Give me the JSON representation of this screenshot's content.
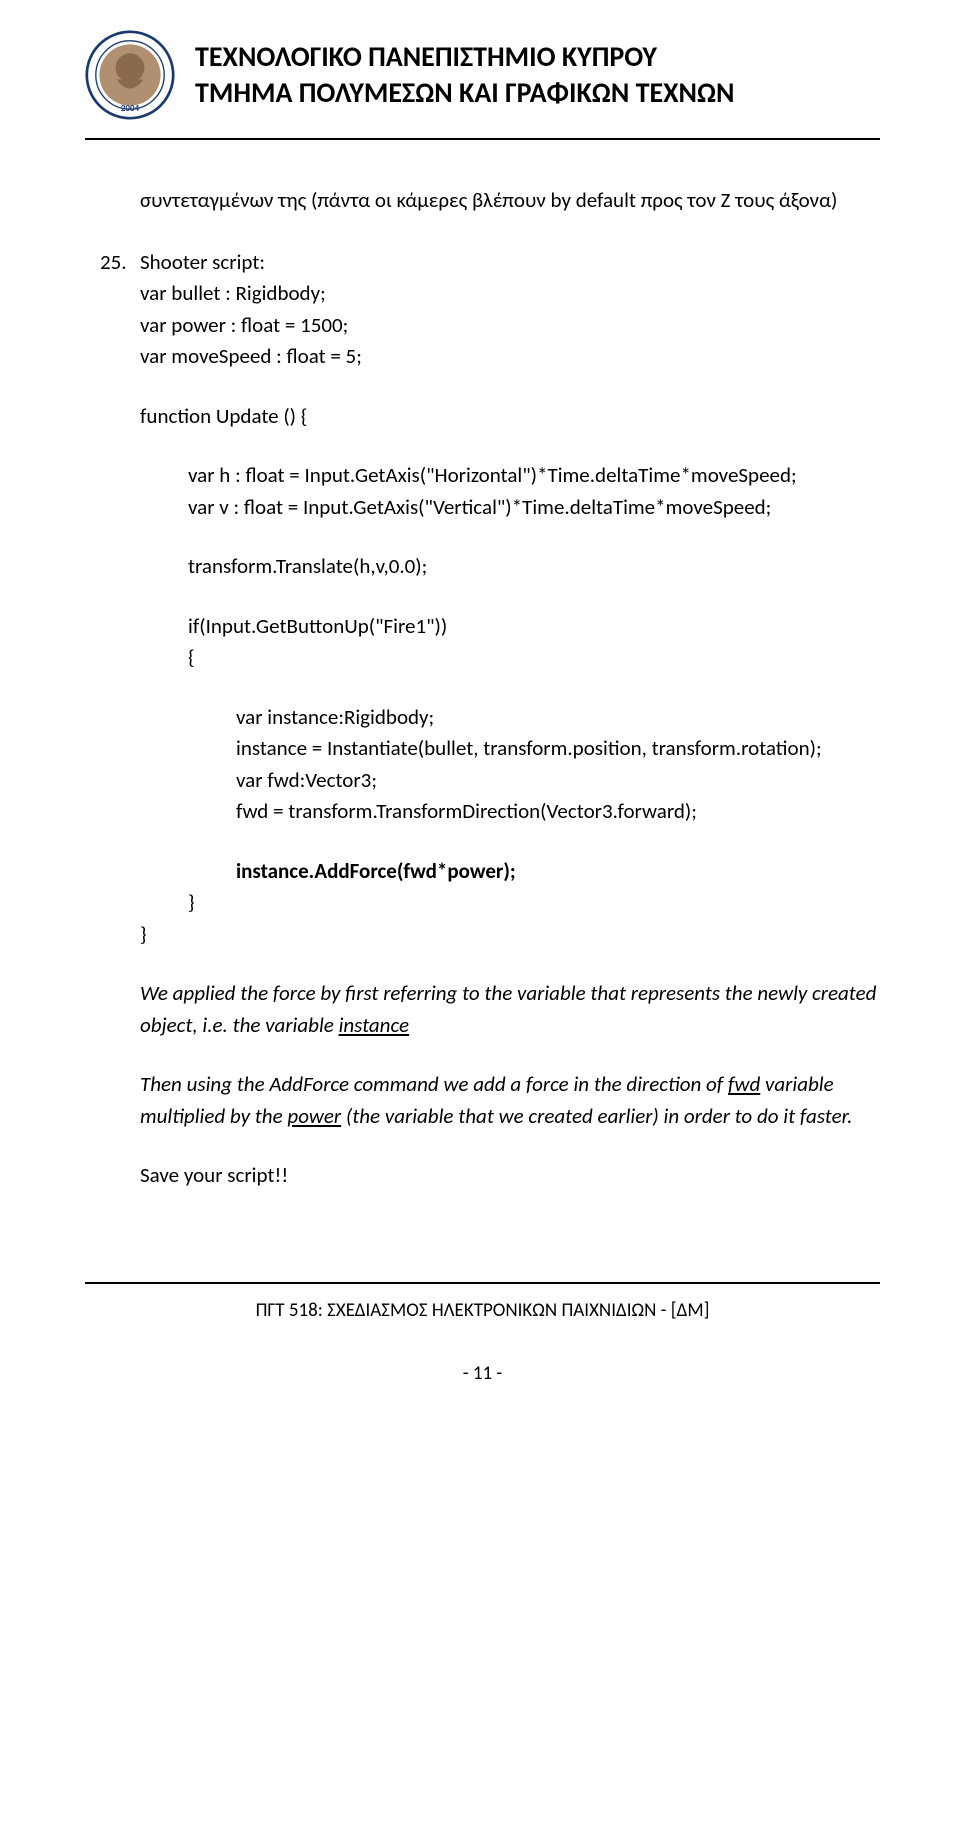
{
  "header": {
    "title_line1": "ΤΕΧΝΟΛΟΓΙΚΟ ΠΑΝΕΠΙΣΤΗΜΙΟ ΚΥΠΡΟΥ",
    "title_line2": "ΤΜΗΜΑ ΠΟΛΥΜΕΣΩΝ ΚΑΙ ΓΡΑΦΙΚΩΝ ΤΕΧΝΩΝ"
  },
  "body": {
    "intro_part1": "συντεταγμένων της (πάντα οι κάμερες βλέπουν by default προς τον Ζ τους άξονα)",
    "list_number": "25.",
    "list_title": "Shooter script:",
    "code": {
      "l1": "var bullet : Rigidbody;",
      "l2": "var power : float = 1500;",
      "l3": "var moveSpeed : float = 5;",
      "l4": "function Update () {",
      "l5": "var h : float = Input.GetAxis(\"Horizontal\")*Time.deltaTime*moveSpeed;",
      "l6": "var v : float = Input.GetAxis(\"Vertical\")*Time.deltaTime*moveSpeed;",
      "l7": "transform.Translate(h,v,0.0);",
      "l8": "if(Input.GetButtonUp(\"Fire1\"))",
      "l9": "{",
      "l10": "var instance:Rigidbody;",
      "l11": "instance = Instantiate(bullet, transform.position, transform.rotation);",
      "l12": "var fwd:Vector3;",
      "l13": "fwd = transform.TransformDirection(Vector3.forward);",
      "l14": "instance.AddForce(fwd*power);",
      "l15a": "}",
      "l15b": "}"
    },
    "note1_a": "We applied the force by first referring to the variable that represents the newly created object, i.e. the variable ",
    "note1_b": "instance",
    "note2_a": "Then using the AddForce command we add a force in the direction of ",
    "note2_b": "fwd",
    "note2_c": " variable multiplied by the ",
    "note2_d": "power",
    "note2_e": " (the variable that we created earlier) in order to do it faster.",
    "save": "Save your script!!"
  },
  "footer": {
    "course": "ΠΓΤ 518: ΣΧΕΔΙΑΣΜΟΣ ΗΛΕΚΤΡΟΝΙΚΩΝ ΠΑΙΧΝΙΔΙΩΝ - [ΔΜ]",
    "page": "- 11 -"
  }
}
